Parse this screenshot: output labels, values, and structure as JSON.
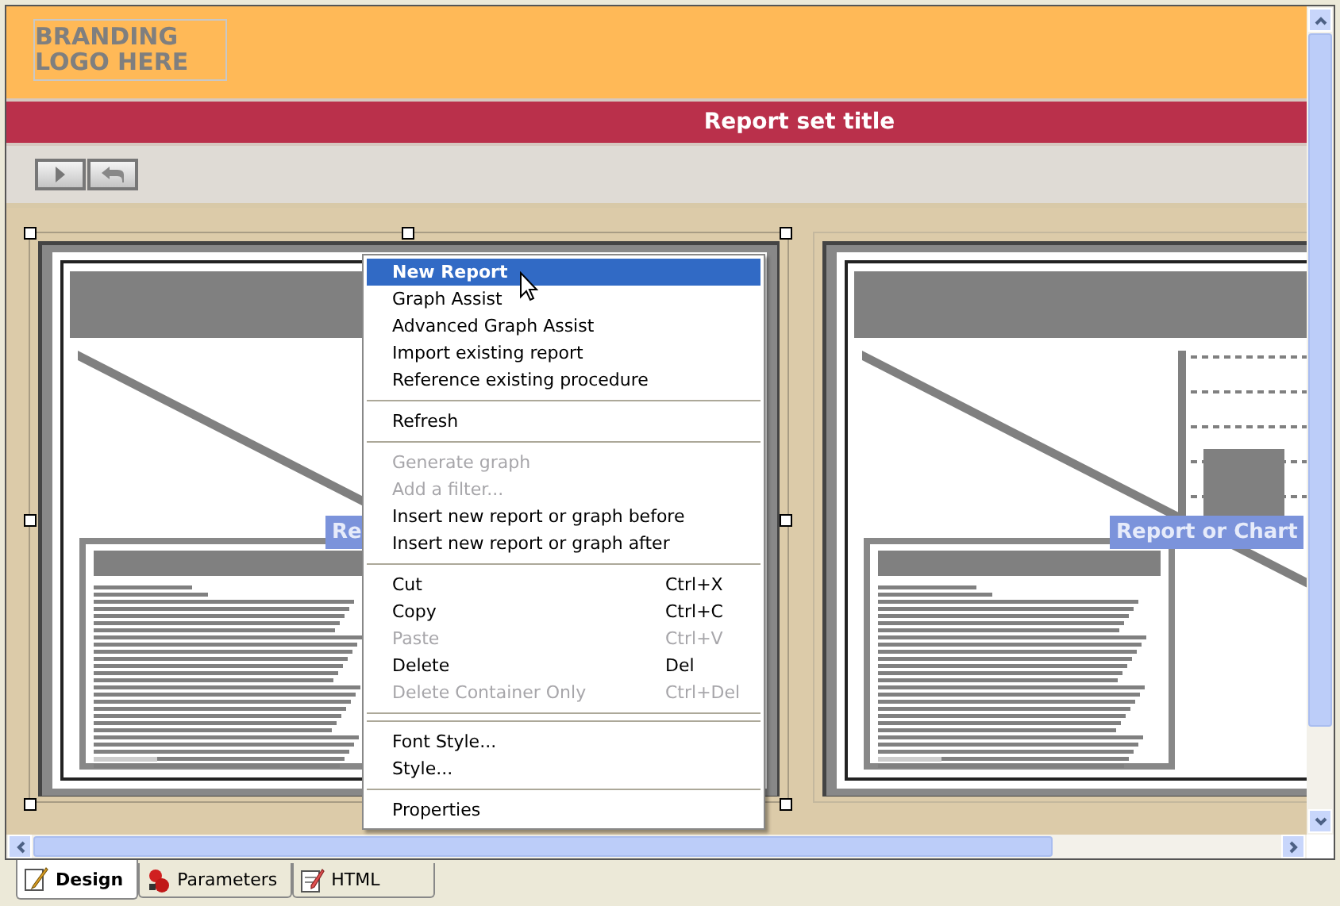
{
  "header": {
    "logo": [
      "BRANDING",
      "LOGO HERE"
    ],
    "title": "Report set title"
  },
  "toolbar": [
    {
      "kind": "run"
    },
    {
      "kind": "undo"
    }
  ],
  "containers": [
    {
      "label": "Re",
      "selected": true,
      "chart": false
    },
    {
      "label": "Report or Chart",
      "selected": false,
      "chart": true
    }
  ],
  "context_menu": [
    {
      "kind": "item",
      "label": "New Report",
      "selected": true,
      "disabled": false,
      "bold": true
    },
    {
      "kind": "item",
      "label": "Graph Assist",
      "selected": false,
      "disabled": false
    },
    {
      "kind": "item",
      "label": "Advanced Graph Assist",
      "selected": false,
      "disabled": false
    },
    {
      "kind": "item",
      "label": "Import existing report",
      "selected": false,
      "disabled": false
    },
    {
      "kind": "item",
      "label": "Reference existing procedure",
      "selected": false,
      "disabled": false
    },
    {
      "kind": "separator"
    },
    {
      "kind": "item",
      "label": "Refresh",
      "selected": false,
      "disabled": false
    },
    {
      "kind": "separator"
    },
    {
      "kind": "item",
      "label": "Generate graph",
      "selected": false,
      "disabled": true
    },
    {
      "kind": "item",
      "label": "Add a filter...",
      "selected": false,
      "disabled": true
    },
    {
      "kind": "item",
      "label": "Insert new report or graph before",
      "selected": false,
      "disabled": false
    },
    {
      "kind": "item",
      "label": "Insert new report or graph after",
      "selected": false,
      "disabled": false
    },
    {
      "kind": "separator"
    },
    {
      "kind": "item",
      "label": "Cut",
      "shortcut": "Ctrl+X",
      "selected": false,
      "disabled": false
    },
    {
      "kind": "item",
      "label": "Copy",
      "shortcut": "Ctrl+C",
      "selected": false,
      "disabled": false
    },
    {
      "kind": "item",
      "label": "Paste",
      "shortcut": "Ctrl+V",
      "selected": false,
      "disabled": true
    },
    {
      "kind": "item",
      "label": "Delete",
      "shortcut": "Del",
      "selected": false,
      "disabled": false
    },
    {
      "kind": "item",
      "label": "Delete Container Only",
      "shortcut": "Ctrl+Del",
      "selected": false,
      "disabled": true
    },
    {
      "kind": "separator"
    },
    {
      "kind": "separator"
    },
    {
      "kind": "item",
      "label": "Font Style...",
      "selected": false,
      "disabled": false
    },
    {
      "kind": "item",
      "label": "Style...",
      "selected": false,
      "disabled": false
    },
    {
      "kind": "separator"
    },
    {
      "kind": "item",
      "label": "Properties",
      "selected": false,
      "disabled": false
    }
  ],
  "tabs": [
    {
      "label": "Design",
      "selected": true
    },
    {
      "label": "Parameters",
      "selected": false
    },
    {
      "label": "HTML",
      "selected": false
    }
  ]
}
